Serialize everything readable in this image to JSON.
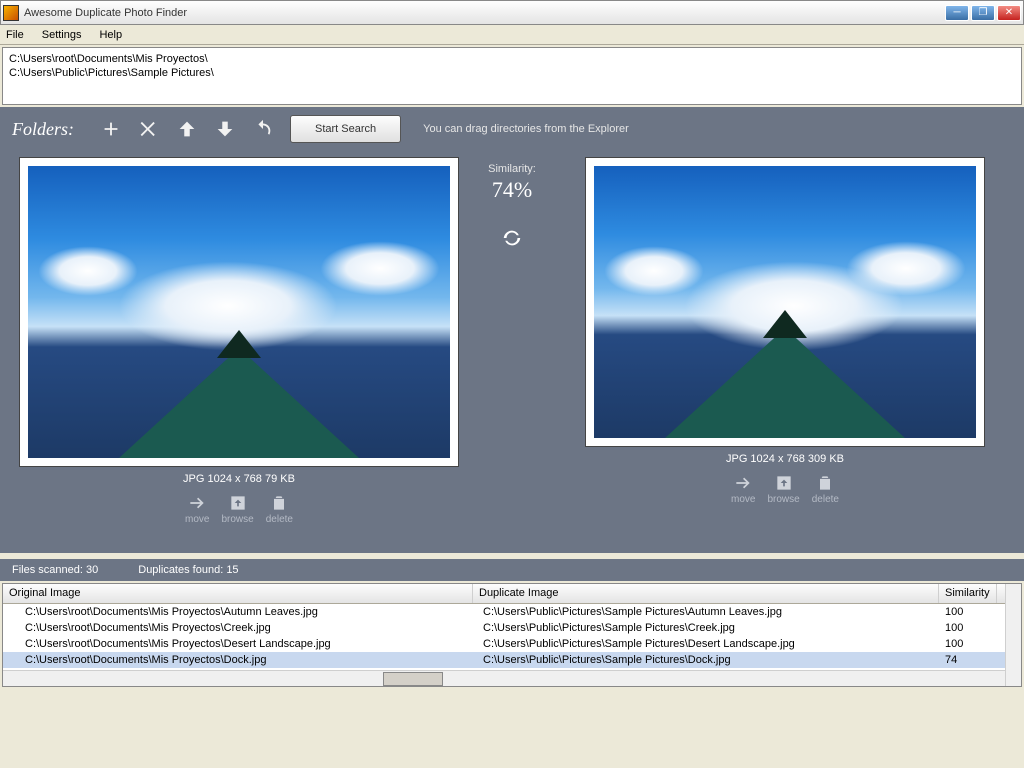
{
  "window": {
    "title": "Awesome Duplicate Photo Finder"
  },
  "menu": {
    "file": "File",
    "settings": "Settings",
    "help": "Help"
  },
  "paths": [
    "C:\\Users\\root\\Documents\\Mis Proyectos\\",
    "C:\\Users\\Public\\Pictures\\Sample Pictures\\"
  ],
  "toolbar": {
    "label": "Folders:",
    "start": "Start Search",
    "hint": "You can drag directories from the Explorer"
  },
  "similarity": {
    "label": "Similarity:",
    "value": "74%"
  },
  "left": {
    "info": "JPG  1024 x 768  79 KB",
    "move": "move",
    "browse": "browse",
    "delete": "delete"
  },
  "right": {
    "info": "JPG  1024 x 768  309 KB",
    "move": "move",
    "browse": "browse",
    "delete": "delete"
  },
  "status": {
    "scanned_label": "Files scanned:",
    "scanned": "30",
    "dup_label": "Duplicates found:",
    "dup": "15"
  },
  "grid": {
    "headers": {
      "orig": "Original Image",
      "dup": "Duplicate Image",
      "sim": "Similarity"
    },
    "rows": [
      {
        "orig": "C:\\Users\\root\\Documents\\Mis Proyectos\\Autumn Leaves.jpg",
        "dup": "C:\\Users\\Public\\Pictures\\Sample Pictures\\Autumn Leaves.jpg",
        "sim": "100",
        "selected": false
      },
      {
        "orig": "C:\\Users\\root\\Documents\\Mis Proyectos\\Creek.jpg",
        "dup": "C:\\Users\\Public\\Pictures\\Sample Pictures\\Creek.jpg",
        "sim": "100",
        "selected": false
      },
      {
        "orig": "C:\\Users\\root\\Documents\\Mis Proyectos\\Desert Landscape.jpg",
        "dup": "C:\\Users\\Public\\Pictures\\Sample Pictures\\Desert Landscape.jpg",
        "sim": "100",
        "selected": false
      },
      {
        "orig": "C:\\Users\\root\\Documents\\Mis Proyectos\\Dock.jpg",
        "dup": "C:\\Users\\Public\\Pictures\\Sample Pictures\\Dock.jpg",
        "sim": "74",
        "selected": true
      }
    ]
  }
}
